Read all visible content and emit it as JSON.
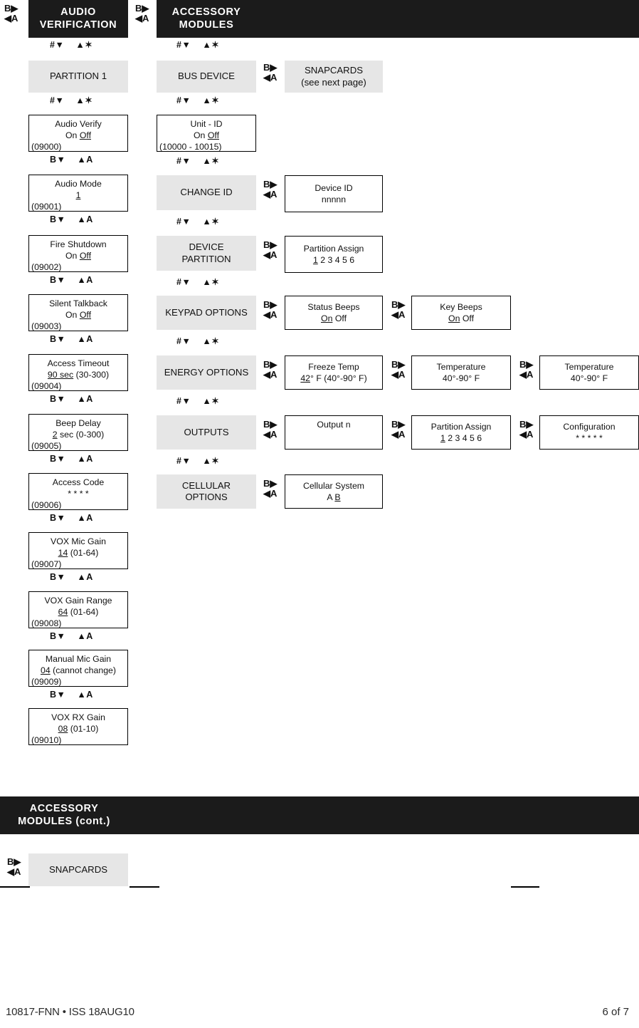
{
  "sections": {
    "audio_verification": {
      "title_line1": "AUDIO",
      "title_line2": "VERIFICATION",
      "entry_connector": {
        "down": "#▼",
        "up": "▲✶"
      },
      "menu": {
        "label": "PARTITION 1"
      },
      "menu_connector": {
        "down": "#▼",
        "up": "▲✶"
      },
      "items": [
        {
          "title": "Audio Verify",
          "value_on": "On",
          "value_off": "Off",
          "selected": "Off",
          "code": "(09000)",
          "value_text": "On Off"
        },
        {
          "title": "Audio Mode",
          "value_text": "1",
          "code": "(09001)"
        },
        {
          "title": "Fire Shutdown",
          "value_text": "On Off",
          "code": "(09002)"
        },
        {
          "title": "Silent Talkback",
          "value_text": "On Off",
          "code": "(09003)"
        },
        {
          "title": "Access Timeout",
          "value_text": "90 sec (30-300)",
          "code": "(09004)"
        },
        {
          "title": "Beep Delay",
          "value_text": "2 sec (0-300)",
          "code": "(09005)"
        },
        {
          "title": "Access Code",
          "value_text": "* * * *",
          "code": "(09006)"
        },
        {
          "title": "VOX Mic Gain",
          "value_text": "14 (01-64)",
          "code": "(09007)"
        },
        {
          "title": "VOX Gain Range",
          "value_text": "64 (01-64)",
          "code": "(09008)"
        },
        {
          "title": "Manual Mic Gain",
          "value_text": "04 (cannot change)",
          "code": "(09009)"
        },
        {
          "title": "VOX RX Gain",
          "value_text": "08 (01-10)",
          "code": "(09010)"
        }
      ],
      "item_connector": {
        "down": "B▼",
        "up": "▲A"
      }
    },
    "accessory_modules": {
      "title_line1": "ACCESSORY",
      "title_line2": "MODULES",
      "entry_connector": {
        "down": "#▼",
        "up": "▲✶"
      },
      "step_connector": {
        "down": "#▼",
        "up": "▲✶"
      },
      "branch_connector": {
        "right": "B▶",
        "left": "◀A"
      },
      "rows": [
        {
          "menu": "BUS DEVICE",
          "side_box": {
            "line1": "SNAPCARDS",
            "line2": "(see next page)",
            "style": "grey"
          },
          "detail": null
        },
        {
          "menu": null,
          "detail": {
            "title": "Unit - ID",
            "value_text": "On Off",
            "code": "(10000 - 10015)"
          }
        },
        {
          "menu": "CHANGE ID",
          "detail": {
            "title": "Device ID",
            "value_text": "nnnnn"
          }
        },
        {
          "menu_line1": "DEVICE",
          "menu_line2": "PARTITION",
          "detail": {
            "title": "Partition Assign",
            "value_text": "1 2 3 4 5 6"
          }
        },
        {
          "menu": "KEYPAD OPTIONS",
          "detail": {
            "title": "Status Beeps",
            "value_text": "On Off"
          },
          "detail2": {
            "title": "Key Beeps",
            "value_text": "On Off"
          }
        },
        {
          "menu": "ENERGY OPTIONS",
          "detail": {
            "title": "Freeze Temp",
            "value_text": "42° F (40°-90° F)"
          },
          "detail2": {
            "title": "Temperature",
            "value_text": "40°-90° F"
          },
          "detail3": {
            "title": "Temperature",
            "value_text": "40°-90° F"
          }
        },
        {
          "menu": "OUTPUTS",
          "detail": {
            "title": "Output n",
            "value_text": ""
          },
          "detail2": {
            "title": "Partition Assign",
            "value_text": "1 2 3 4 5 6"
          },
          "detail3": {
            "title": "Configuration",
            "value_text": "* * * * *"
          }
        },
        {
          "menu_line1": "CELLULAR",
          "menu_line2": "OPTIONS",
          "detail": {
            "title": "Cellular System",
            "value_text": "A B"
          }
        }
      ]
    },
    "accessory_modules_cont": {
      "title_line1": "ACCESSORY",
      "title_line2": "MODULES (cont.)",
      "branch_connector": {
        "right": "B▶",
        "left": "◀A"
      },
      "menu": {
        "label": "SNAPCARDS"
      }
    }
  },
  "footer": {
    "left": "10817-FNN • ISS 18AUG10",
    "right": "6 of 7"
  },
  "colors": {
    "header_bar": "#1b1b1b",
    "menu_box": "#e6e6e6",
    "border": "#000000",
    "text": "#111111"
  }
}
